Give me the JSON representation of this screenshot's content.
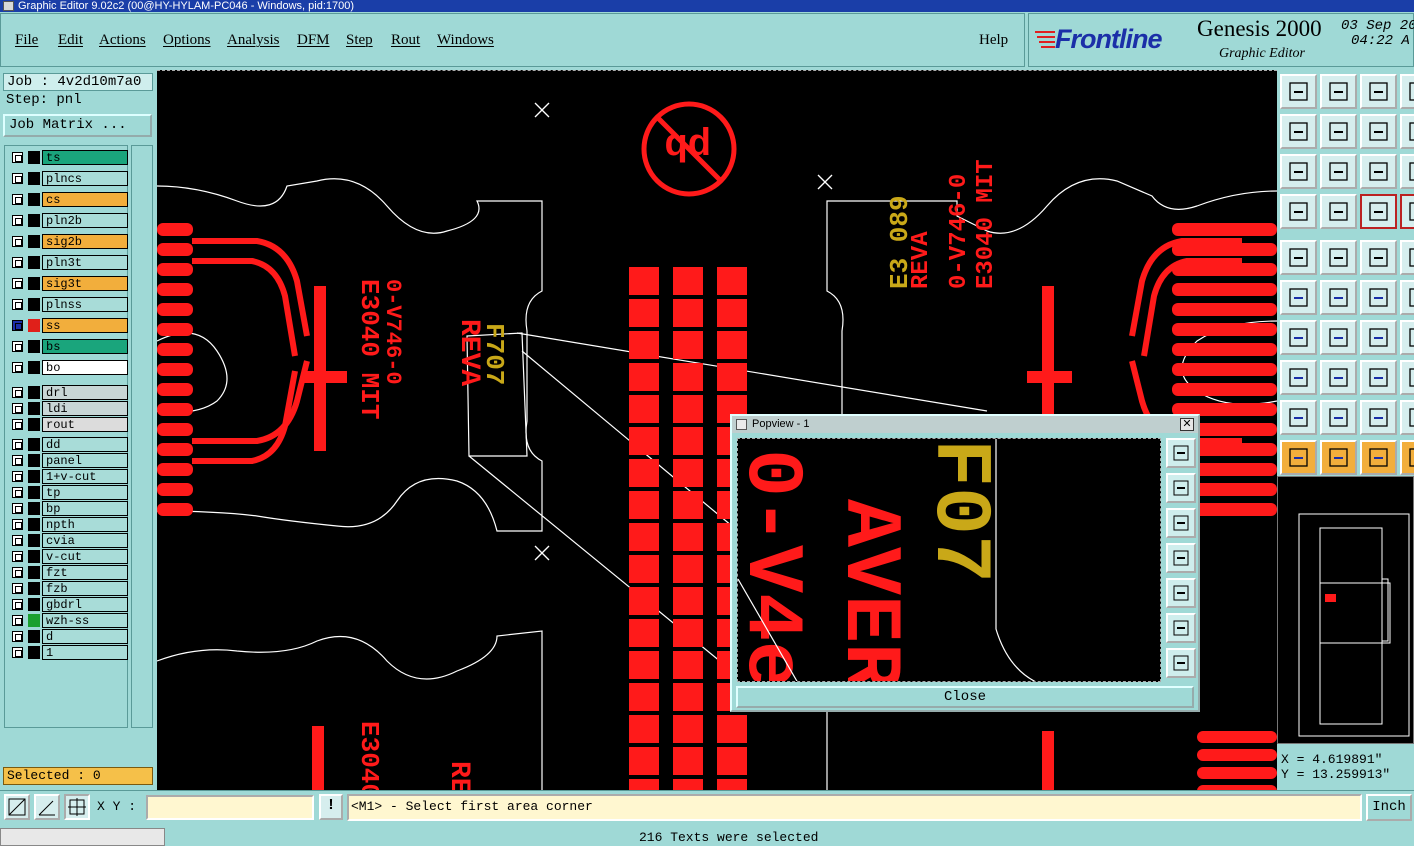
{
  "window": {
    "title": "Graphic Editor 9.02c2 (00@HY-HYLAM-PC046 - Windows, pid:1700)"
  },
  "menu": [
    "File",
    "Edit",
    "Actions",
    "Options",
    "Analysis",
    "DFM",
    "Step",
    "Rout",
    "Windows"
  ],
  "help_label": "Help",
  "brand": {
    "logo": "Frontline",
    "product": "Genesis 2000",
    "subtitle": "Graphic Editor",
    "date": "03 Sep 20",
    "time": "04:22 A"
  },
  "job": {
    "job_label": "Job : 4v2d10m7a0",
    "step_label": "Step: pnl",
    "matrix_button": "Job Matrix ..."
  },
  "layers": [
    {
      "name": "ts",
      "color": "#1aa57c",
      "swatch": "#000000"
    },
    {
      "name": "plncs",
      "color": "#a8dcd8",
      "swatch": "#000000"
    },
    {
      "name": "cs",
      "color": "#f2ae3c",
      "swatch": "#000000"
    },
    {
      "name": "pln2b",
      "color": "#a8dcd8",
      "swatch": "#000000"
    },
    {
      "name": "sig2b",
      "color": "#f2ae3c",
      "swatch": "#000000"
    },
    {
      "name": "pln3t",
      "color": "#a8dcd8",
      "swatch": "#000000"
    },
    {
      "name": "sig3t",
      "color": "#f2ae3c",
      "swatch": "#000000"
    },
    {
      "name": "plnss",
      "color": "#a8dcd8",
      "swatch": "#000000"
    },
    {
      "name": "ss",
      "color": "#f2ae3c",
      "swatch": "#e0201a",
      "active": true
    },
    {
      "name": "bs",
      "color": "#1aa57c",
      "swatch": "#000000"
    },
    {
      "name": "bo",
      "color": "#ffffff",
      "swatch": "#000000"
    },
    {
      "name": "drl",
      "color": "#c8d6d6",
      "swatch": "#000000"
    },
    {
      "name": "ldi",
      "color": "#c8d6d6",
      "swatch": "#000000"
    },
    {
      "name": "rout",
      "color": "#dcdcdc",
      "swatch": "#000000"
    },
    {
      "name": "dd",
      "color": "#a8dcd8",
      "swatch": "#000000"
    },
    {
      "name": "panel",
      "color": "#a8dcd8",
      "swatch": "#000000"
    },
    {
      "name": "1+v-cut",
      "color": "#a8dcd8",
      "swatch": "#000000"
    },
    {
      "name": "tp",
      "color": "#a8dcd8",
      "swatch": "#000000"
    },
    {
      "name": "bp",
      "color": "#a8dcd8",
      "swatch": "#000000"
    },
    {
      "name": "npth",
      "color": "#a8dcd8",
      "swatch": "#000000"
    },
    {
      "name": "cvia",
      "color": "#a8dcd8",
      "swatch": "#000000"
    },
    {
      "name": "v-cut",
      "color": "#a8dcd8",
      "swatch": "#000000"
    },
    {
      "name": "fzt",
      "color": "#a8dcd8",
      "swatch": "#000000"
    },
    {
      "name": "fzb",
      "color": "#a8dcd8",
      "swatch": "#000000"
    },
    {
      "name": "gbdrl",
      "color": "#a8dcd8",
      "swatch": "#000000"
    },
    {
      "name": "wzh-ss",
      "color": "#a8dcd8",
      "swatch": "#1aa030"
    },
    {
      "name": "d",
      "color": "#a8dcd8",
      "swatch": "#000000"
    },
    {
      "name": "1",
      "color": "#a8dcd8",
      "swatch": "#000000"
    }
  ],
  "selected_label": "Selected : 0",
  "popview": {
    "title": "Popview - 1",
    "close_label": "Close"
  },
  "coords": {
    "x": "X = 4.619891\"",
    "y": "Y = 13.259913\""
  },
  "statusbar": {
    "xy_label": "X Y :",
    "xy_value": "",
    "message": "<M1> - Select first area corner",
    "units": "Inch"
  },
  "bottom_message": "216 Texts were selected",
  "colors": {
    "panel": "#9fd9d6",
    "feature": "#ff1a1a",
    "selected_text": "#b5a21c",
    "outline": "#ffffff"
  }
}
